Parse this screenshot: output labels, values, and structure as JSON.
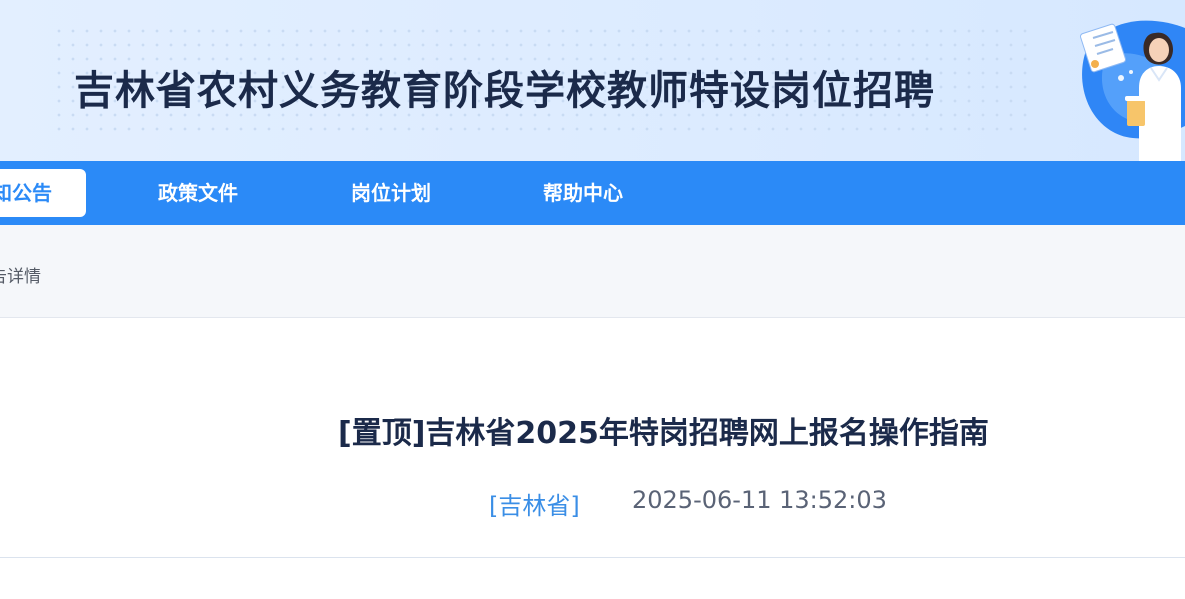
{
  "header": {
    "site_title": "吉林省农村义务教育阶段学校教师特设岗位招聘"
  },
  "nav": {
    "items": [
      {
        "label": "知公告",
        "active": true
      },
      {
        "label": "政策文件",
        "active": false
      },
      {
        "label": "岗位计划",
        "active": false
      },
      {
        "label": "帮助中心",
        "active": false
      }
    ]
  },
  "breadcrumb": {
    "current": "告详情"
  },
  "article": {
    "title": "[置顶]吉林省2025年特岗招聘网上报名操作指南",
    "source": "[吉林省]",
    "date": "2025-06-11 13:52:03"
  },
  "colors": {
    "nav_blue": "#2b8af7",
    "title_dark": "#1b2a4a",
    "link_blue": "#3a8ee6",
    "banner_bg": "#dcebff"
  }
}
